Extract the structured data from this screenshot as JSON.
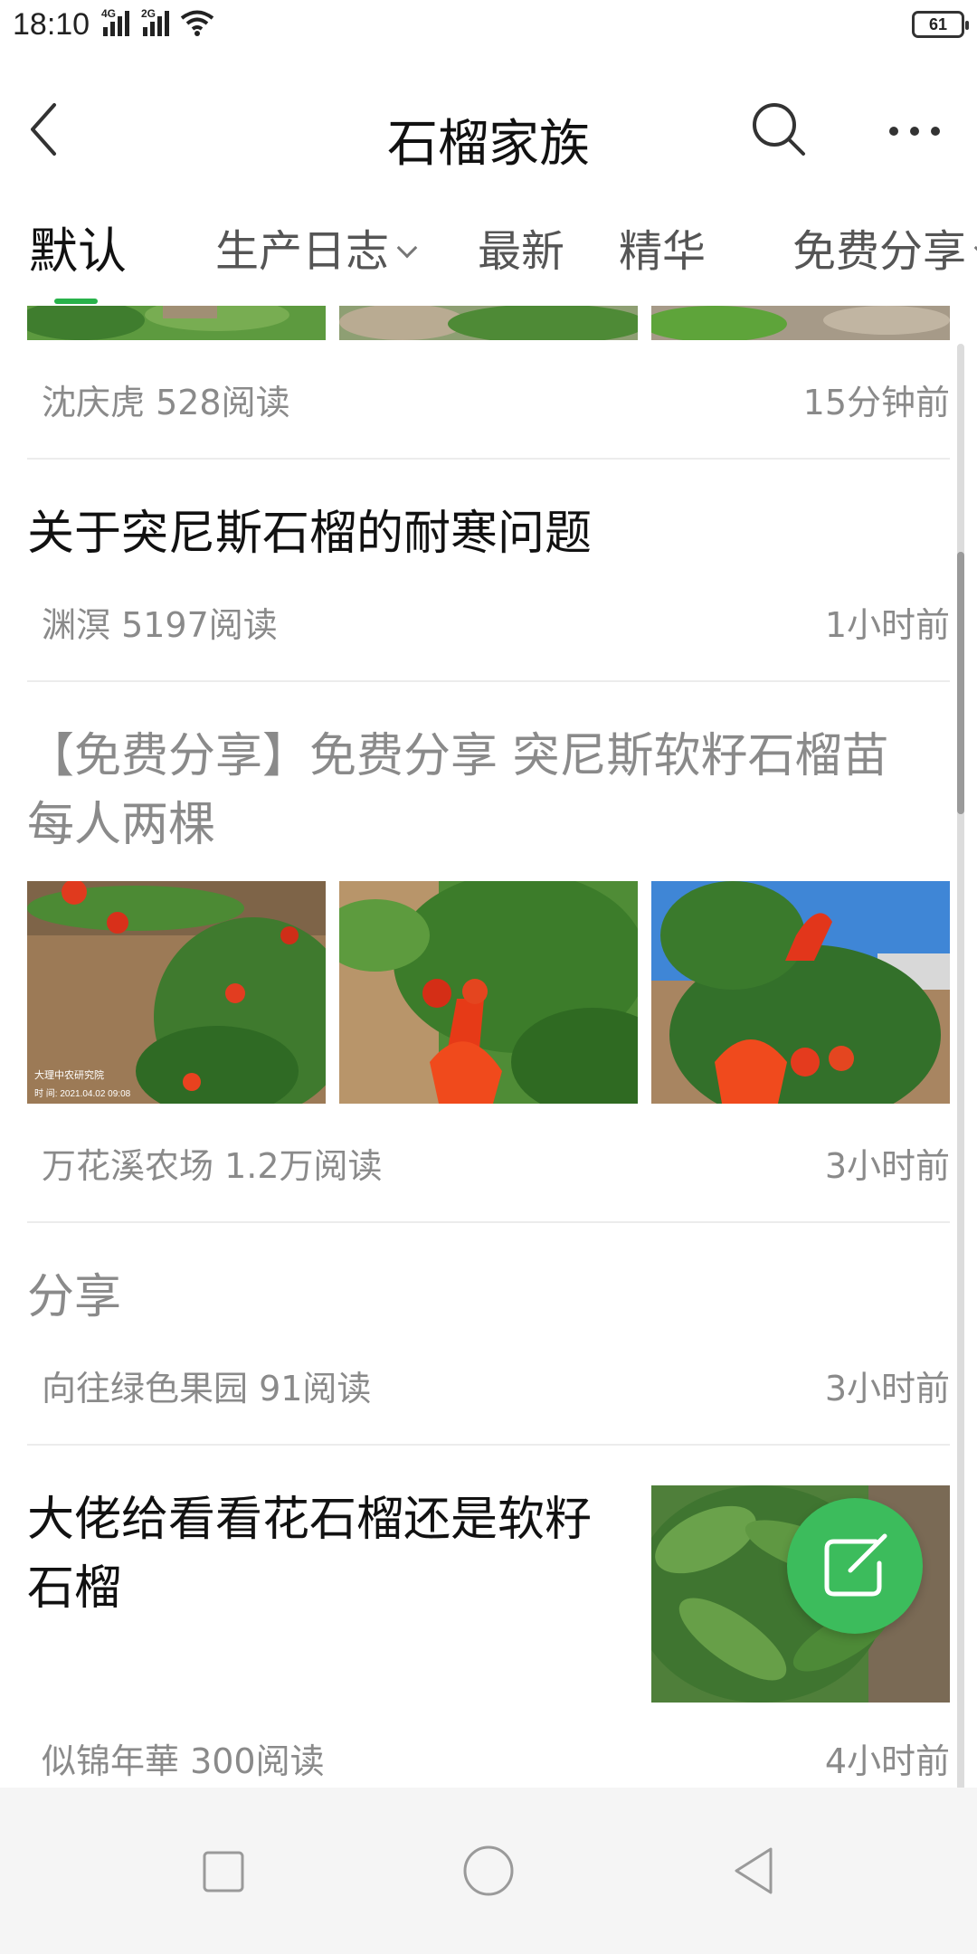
{
  "status_bar": {
    "time": "18:10",
    "signal_1_label": "4G",
    "signal_2_label": "2G",
    "battery": "61"
  },
  "header": {
    "title": "石榴家族",
    "icons": [
      "back-icon",
      "search-icon",
      "more-icon"
    ]
  },
  "tabs": [
    {
      "label": "默认",
      "active": true
    },
    {
      "label": "生产日志",
      "has_dropdown": true
    },
    {
      "label": "最新"
    },
    {
      "label": "精华"
    },
    {
      "label": "免费分享",
      "has_dropdown": true
    }
  ],
  "posts": [
    {
      "author_reads": "沈庆虎 528阅读",
      "time": "15分钟前"
    },
    {
      "title": "关于突尼斯石榴的耐寒问题",
      "author_reads": "渊溟 5197阅读",
      "time": "1小时前"
    },
    {
      "title": "【免费分享】免费分享 突尼斯软籽石榴苗",
      "title_line2": "每人两棵",
      "author_reads": "万花溪农场 1.2万阅读",
      "time": "3小时前",
      "image_watermark": "大理中农研究院",
      "image_watermark_time": "时 间: 2021.04.02 09:08"
    },
    {
      "title": "分享",
      "author_reads": "向往绿色果园 91阅读",
      "time": "3小时前"
    },
    {
      "title": "大佬给看看花石榴还是软籽",
      "title_line2": "石榴",
      "author_reads": "似锦年華 300阅读",
      "time": "4小时前"
    }
  ],
  "colors": {
    "accent": "#3cbc5c",
    "meta_text": "#8a8a8a"
  }
}
